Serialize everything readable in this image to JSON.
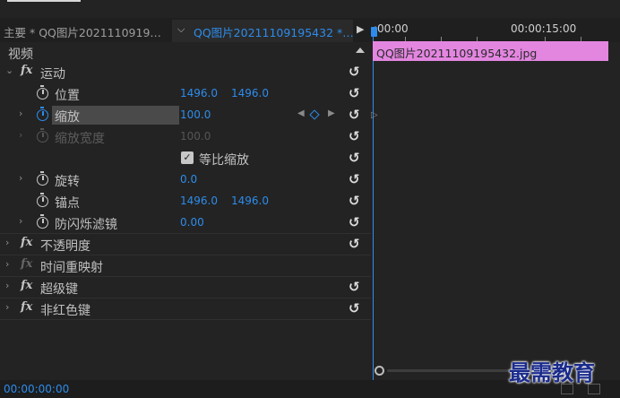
{
  "header": {
    "master_tab": "主要 * QQ图片2021110919…",
    "sequence_tab": "QQ图片20211109195432 *…"
  },
  "ruler": {
    "start": ":00:00",
    "mark": "00:00:15:00"
  },
  "section": {
    "title": "视频"
  },
  "effects": {
    "motion": {
      "label": "运动",
      "position": {
        "label": "位置",
        "x": "1496.0",
        "y": "1496.0"
      },
      "scale": {
        "label": "缩放",
        "value": "100.0"
      },
      "scale_width": {
        "label": "缩放宽度",
        "value": "100.0"
      },
      "uniform_scale": {
        "label": "等比缩放",
        "checked": true
      },
      "rotation": {
        "label": "旋转",
        "value": "0.0"
      },
      "anchor": {
        "label": "锚点",
        "x": "1496.0",
        "y": "1496.0"
      },
      "anti_flicker": {
        "label": "防闪烁滤镜",
        "value": "0.00"
      }
    },
    "opacity": {
      "label": "不透明度"
    },
    "time_remap": {
      "label": "时间重映射"
    },
    "ultra_key": {
      "label": "超级键"
    },
    "non_red_key": {
      "label": "非红色键"
    }
  },
  "clip": {
    "name": "QQ图片20211109195432.jpg",
    "color": "#e386e0"
  },
  "footer": {
    "timecode": "00:00:00:00",
    "watermark": "最需教育"
  },
  "colors": {
    "accent": "#2d8ceb",
    "background": "#232323"
  }
}
